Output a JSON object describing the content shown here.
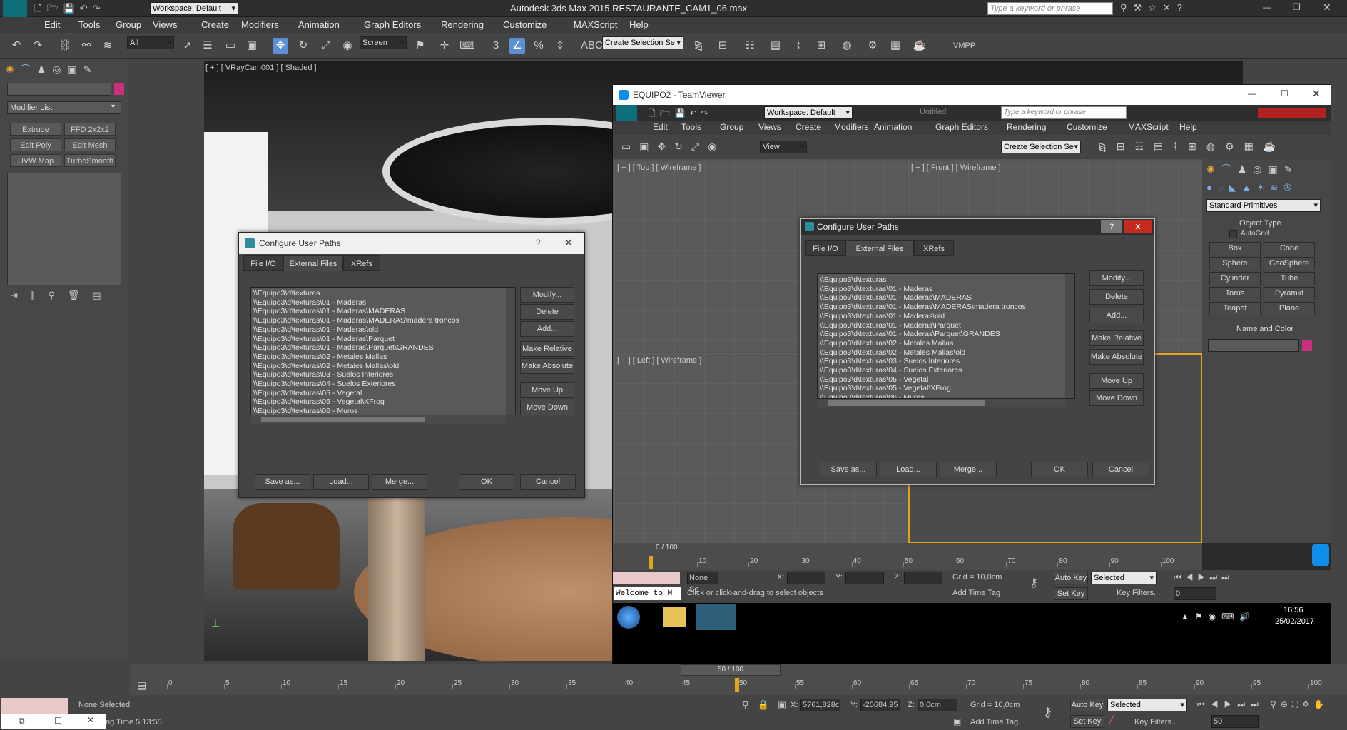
{
  "app": {
    "title": "Autodesk 3ds Max 2015    RESTAURANTE_CAM1_06.max",
    "workspace": "Workspace: Default",
    "search_placeholder": "Type a keyword or phrase",
    "logo": "MAX"
  },
  "menu": [
    "Edit",
    "Tools",
    "Group",
    "Views",
    "Create",
    "Modifiers",
    "Animation",
    "Graph Editors",
    "Rendering",
    "Customize",
    "MAXScript",
    "Help"
  ],
  "toolbar": {
    "filter": "All",
    "ref_coord": "Screen",
    "sel_set": "Create Selection Se",
    "vmpp": "VMPP"
  },
  "left_panel": {
    "modifier_list": "Modifier List",
    "buttons": [
      "Extrude",
      "FFD 2x2x2",
      "Edit Poly",
      "Edit Mesh",
      "UVW Map",
      "TurboSmooth"
    ]
  },
  "viewport": {
    "label": "[ + ] [ VRayCam001 ] [ Shaded ]"
  },
  "dialog1": {
    "title": "Configure User Paths",
    "help": "?",
    "close": "✕",
    "tabs": [
      "File I/O",
      "External Files",
      "XRefs"
    ],
    "paths": [
      "\\\\Equipo3\\d\\texturas",
      "\\\\Equipo3\\d\\texturas\\01 - Maderas",
      "\\\\Equipo3\\d\\texturas\\01 - Maderas\\MADERAS",
      "\\\\Equipo3\\d\\texturas\\01 - Maderas\\MADERAS\\madera troncos",
      "\\\\Equipo3\\d\\texturas\\01 - Maderas\\old",
      "\\\\Equipo3\\d\\texturas\\01 - Maderas\\Parquet",
      "\\\\Equipo3\\d\\texturas\\01 - Maderas\\Parquet\\GRANDES",
      "\\\\Equipo3\\d\\texturas\\02 - Metales Mallas",
      "\\\\Equipo3\\d\\texturas\\02 - Metales Mallas\\old",
      "\\\\Equipo3\\d\\texturas\\03 - Suelos Interiores",
      "\\\\Equipo3\\d\\texturas\\04 - Suelos Exteriores",
      "\\\\Equipo3\\d\\texturas\\05 - Vegetal",
      "\\\\Equipo3\\d\\texturas\\05 - Vegetal\\XFrog",
      "\\\\Equipo3\\d\\texturas\\06 - Muros"
    ],
    "side_buttons": [
      "Modify...",
      "Delete",
      "Add...",
      "Make Relative",
      "Make Absolute",
      "Move Up",
      "Move Down"
    ],
    "bottom_buttons": [
      "Save as...",
      "Load...",
      "Merge...",
      "OK",
      "Cancel"
    ]
  },
  "teamviewer": {
    "title": "EQUIPO2 - TeamViewer",
    "untitled": "Untitled",
    "workspace": "Workspace: Default",
    "search_placeholder": "Type a keyword or phrase",
    "view_dd": "View",
    "sel_set": "Create Selection Se",
    "vp_top": "[ + ] [ Top ] [ Wireframe ]",
    "vp_front": "[ + ] [ Front ] [ Wireframe ]",
    "vp_left": "[ + ] [ Left ] [ Wireframe ]",
    "cmd": {
      "category": "Standard Primitives",
      "object_type": "Object Type",
      "autogrid": "AutoGrid",
      "prims": [
        "Box",
        "Cone",
        "Sphere",
        "GeoSphere",
        "Cylinder",
        "Tube",
        "Torus",
        "Pyramid",
        "Teapot",
        "Plane"
      ],
      "name_color": "Name and Color"
    },
    "frame": "0 / 100",
    "ticks": [
      "10",
      "20",
      "30",
      "40",
      "50",
      "60",
      "70",
      "80",
      "90",
      "100"
    ],
    "status": {
      "none_sel": "None Se",
      "x": "X:",
      "y": "Y:",
      "z": "Z:",
      "grid": "Grid = 10,0cm",
      "autokey": "Auto Key",
      "selected": "Selected",
      "setkey": "Set Key",
      "keyfilters": "Key Filters...",
      "frame_field": "0",
      "prompt": "Click or click-and-drag to select objects",
      "add_time_tag": "Add Time Tag",
      "welcome": "Welcome to M"
    },
    "taskbar": {
      "time": "16:56",
      "date": "25/02/2017"
    }
  },
  "bottom": {
    "frame": "50 / 100",
    "ticks": [
      "0",
      "5",
      "10",
      "15",
      "20",
      "25",
      "30",
      "35",
      "40",
      "45",
      "50",
      "55",
      "60",
      "65",
      "70",
      "75",
      "80",
      "85",
      "90",
      "95",
      "100"
    ],
    "none_selected": "None Selected",
    "x": "X:",
    "x_val": "5761,828c",
    "y": "Y:",
    "y_val": "-20684,95",
    "z": "Z:",
    "z_val": "0,0cm",
    "grid": "Grid = 10,0cm",
    "autokey": "Auto Key",
    "selected": "Selected",
    "setkey": "Set Key",
    "keyfilters": "Key Filters...",
    "frame_field": "50",
    "add_time_tag": "Add Time Tag",
    "rendering_time": "ng Time  5:13:55"
  }
}
